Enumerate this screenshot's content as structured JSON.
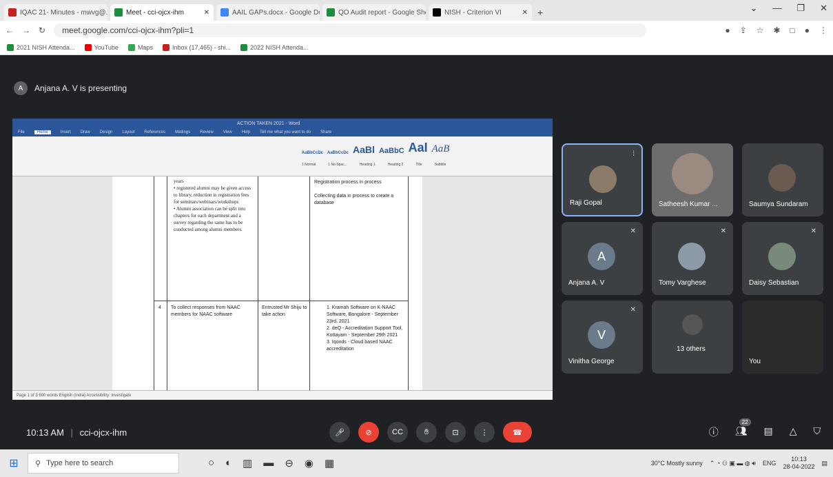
{
  "browser": {
    "tabs": [
      {
        "label": "IQAC 21- Minutes - mwvg@...",
        "icon_color": "#c5221f"
      },
      {
        "label": "Meet - cci-ojcx-ihm",
        "icon_color": "#1e8e3e",
        "active": true
      },
      {
        "label": "AAIL GAPs.docx - Google Docs",
        "icon_color": "#4285f4"
      },
      {
        "label": "QO Audit report - Google Sheets",
        "icon_color": "#1e8e3e"
      },
      {
        "label": "NISH - Criterion VI",
        "icon_color": "#000000"
      }
    ],
    "new_tab": "+",
    "url": "meet.google.com/cci-ojcx-ihm?pli=1",
    "bookmarks": [
      "2021 NISH Attenda...",
      "YouTube",
      "Maps",
      "Inbox (17,465) - shi...",
      "2022 NISH Attenda..."
    ]
  },
  "meet": {
    "presenter_initial": "A",
    "presenting_text": "Anjana A. V is presenting",
    "word": {
      "title": "ACTION TAKEN 2021 - Word",
      "menu": [
        "File",
        "Home",
        "Insert",
        "Draw",
        "Design",
        "Layout",
        "References",
        "Mailings",
        "Review",
        "View",
        "Help",
        "Tell me what you want to do",
        "Share"
      ],
      "styles": [
        "AaBbCcDc",
        "AaBbCcDc",
        "AaBl",
        "AaBbC",
        "AaI",
        "AaB"
      ],
      "style_names": [
        "1 Normal",
        "1 No Spac...",
        "Heading 1",
        "Heading 2",
        "Title",
        "Subtitle"
      ],
      "bullets_top": "years\n• registered alumni may be given access to library, reduction in registration fees for seminars/webinars/workshops\n• Alumni association can be split into chapters for each department and a survey regarding the same has to be conducted among alumni members.",
      "col4_top": "Registration process in process\n\nCollecting data in process to create a database",
      "row_num": "4",
      "row_desc": "To collect responses from NAAC members for NAAC software",
      "row_action": "Entrusted Mr Shiju to take action",
      "row_result": "1. Kramah Software on K-NAAC Software, Bangalore - September 23rd, 2021\n2. deQ - Accreditation Support Tool, Kottayam - September 29th 2021\n3. Iqonds - Cloud based NAAC accreditation",
      "status": "Page 1 of 3    600 words    English (India)    Accessibility: Investigate"
    },
    "participants": [
      {
        "name": "Raji Gopal",
        "initial": "",
        "color": "#5f6368"
      },
      {
        "name": "Satheesh Kumar ...",
        "initial": "",
        "color": "#6d6d6d"
      },
      {
        "name": "Saumya Sundaram",
        "initial": "",
        "color": "#5f6368"
      },
      {
        "name": "Anjana A. V",
        "initial": "A",
        "color": "#6b7b8c"
      },
      {
        "name": "Tomy Varghese",
        "initial": "",
        "color": "#8d9ba8"
      },
      {
        "name": "Daisy Sebastian",
        "initial": "",
        "color": "#7a8a7a"
      },
      {
        "name": "Vinitha George",
        "initial": "V",
        "color": "#6b7b8c"
      },
      {
        "name": "13 others",
        "initial": "",
        "color": "#555"
      },
      {
        "name": "You",
        "initial": "",
        "color": "#2b2b2b"
      }
    ],
    "time": "10:13 AM",
    "separator": "|",
    "meeting_code": "cci-ojcx-ihm",
    "people_count": "22"
  },
  "taskbar": {
    "search_placeholder": "Type here to search",
    "weather": "30°C  Mostly sunny",
    "lang": "ENG",
    "clock_time": "10:13",
    "clock_date": "28-04-2022"
  }
}
